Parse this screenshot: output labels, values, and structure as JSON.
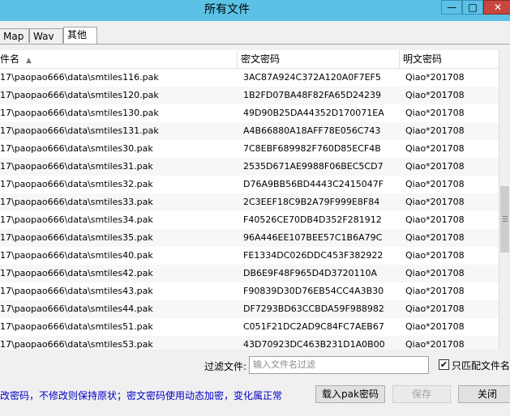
{
  "window": {
    "title": "所有文件",
    "minimize_glyph": "—",
    "maximize_glyph": "□",
    "close_glyph": "✕"
  },
  "tabs": [
    {
      "label": "Map"
    },
    {
      "label": "Wav"
    },
    {
      "label": "其他"
    }
  ],
  "table": {
    "columns": [
      "件名",
      "密文密码",
      "明文密码"
    ],
    "sort_indicator": "▲",
    "rows": [
      {
        "file": "17\\paopao666\\data\\smtiles116.pak",
        "cipher": "3AC87A924C372A120A0F7EF5",
        "plain": "Qiao*201708"
      },
      {
        "file": "17\\paopao666\\data\\smtiles120.pak",
        "cipher": "1B2FD07BA48F82FA65D24239",
        "plain": "Qiao*201708"
      },
      {
        "file": "17\\paopao666\\data\\smtiles130.pak",
        "cipher": "49D90B25DA44352D170071EA",
        "plain": "Qiao*201708"
      },
      {
        "file": "17\\paopao666\\data\\smtiles131.pak",
        "cipher": "A4B66880A18AFF78E056C743",
        "plain": "Qiao*201708"
      },
      {
        "file": "17\\paopao666\\data\\smtiles30.pak",
        "cipher": "7C8EBF689982F760D85ECF4B",
        "plain": "Qiao*201708"
      },
      {
        "file": "17\\paopao666\\data\\smtiles31.pak",
        "cipher": "2535D671AE9988F06BEC5CD7",
        "plain": "Qiao*201708"
      },
      {
        "file": "17\\paopao666\\data\\smtiles32.pak",
        "cipher": "D76A9BB56BD4443C2415047F",
        "plain": "Qiao*201708"
      },
      {
        "file": "17\\paopao666\\data\\smtiles33.pak",
        "cipher": "2C3EEF18C9B2A79F999E8F84",
        "plain": "Qiao*201708"
      },
      {
        "file": "17\\paopao666\\data\\smtiles34.pak",
        "cipher": "F40526CE70DB4D352F281912",
        "plain": "Qiao*201708"
      },
      {
        "file": "17\\paopao666\\data\\smtiles35.pak",
        "cipher": "96A446EE107BEE57C1B6A79C",
        "plain": "Qiao*201708"
      },
      {
        "file": "17\\paopao666\\data\\smtiles40.pak",
        "cipher": "FE1334DC026DDC453F382922",
        "plain": "Qiao*201708"
      },
      {
        "file": "17\\paopao666\\data\\smtiles42.pak",
        "cipher": "DB6E9F48F965D4D3720110A",
        "plain": "Qiao*201708"
      },
      {
        "file": "17\\paopao666\\data\\smtiles43.pak",
        "cipher": "F90839D30D76EB54CC4A3B30",
        "plain": "Qiao*201708"
      },
      {
        "file": "17\\paopao666\\data\\smtiles44.pak",
        "cipher": "DF7293BD63CCBDA59F988982",
        "plain": "Qiao*201708"
      },
      {
        "file": "17\\paopao666\\data\\smtiles51.pak",
        "cipher": "C051F21DC2AD9C84FC7AEB67",
        "plain": "Qiao*201708"
      },
      {
        "file": "17\\paopao666\\data\\smtiles53.pak",
        "cipher": "43D70923DC463B231D1A0B00",
        "plain": "Qiao*201708"
      }
    ]
  },
  "filter": {
    "label": "过滤文件:",
    "placeholder": "输入文件名过滤",
    "checkbox_label": "只匹配文件名",
    "checked_glyph": "✔"
  },
  "footer": {
    "info": "改密码，不修改则保持原状；密文密码使用动态加密，变化属正常",
    "import_label": "载入pak密码",
    "save_label": "保存",
    "close_label": "关闭"
  },
  "colors": {
    "titlebar": "#5bc2e6",
    "close_button": "#c7463f",
    "info_text": "#0000c8"
  }
}
